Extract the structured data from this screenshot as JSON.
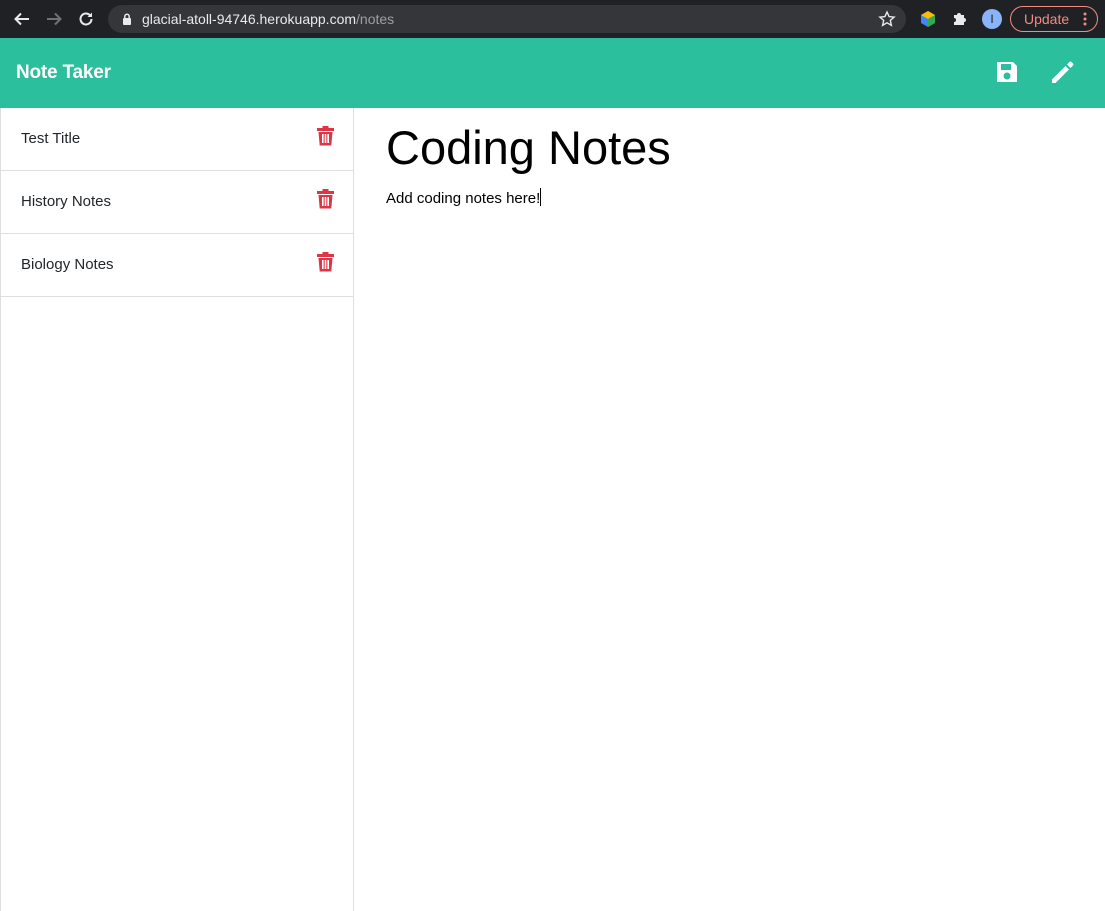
{
  "browser": {
    "url_host": "glacial-atoll-94746.herokuapp.com",
    "url_path": "/notes",
    "profile_initial": "I",
    "update_label": "Update"
  },
  "app": {
    "brand": "Note Taker",
    "accent_color": "#2bbf9d",
    "delete_color": "#dc3545"
  },
  "notes": [
    {
      "title": "Test Title"
    },
    {
      "title": "History Notes"
    },
    {
      "title": "Biology Notes"
    }
  ],
  "editor": {
    "title": "Coding Notes",
    "text": "Add coding notes here!"
  },
  "icons": {
    "save": "save-icon",
    "new_note": "pencil-icon",
    "delete": "trash-icon"
  }
}
